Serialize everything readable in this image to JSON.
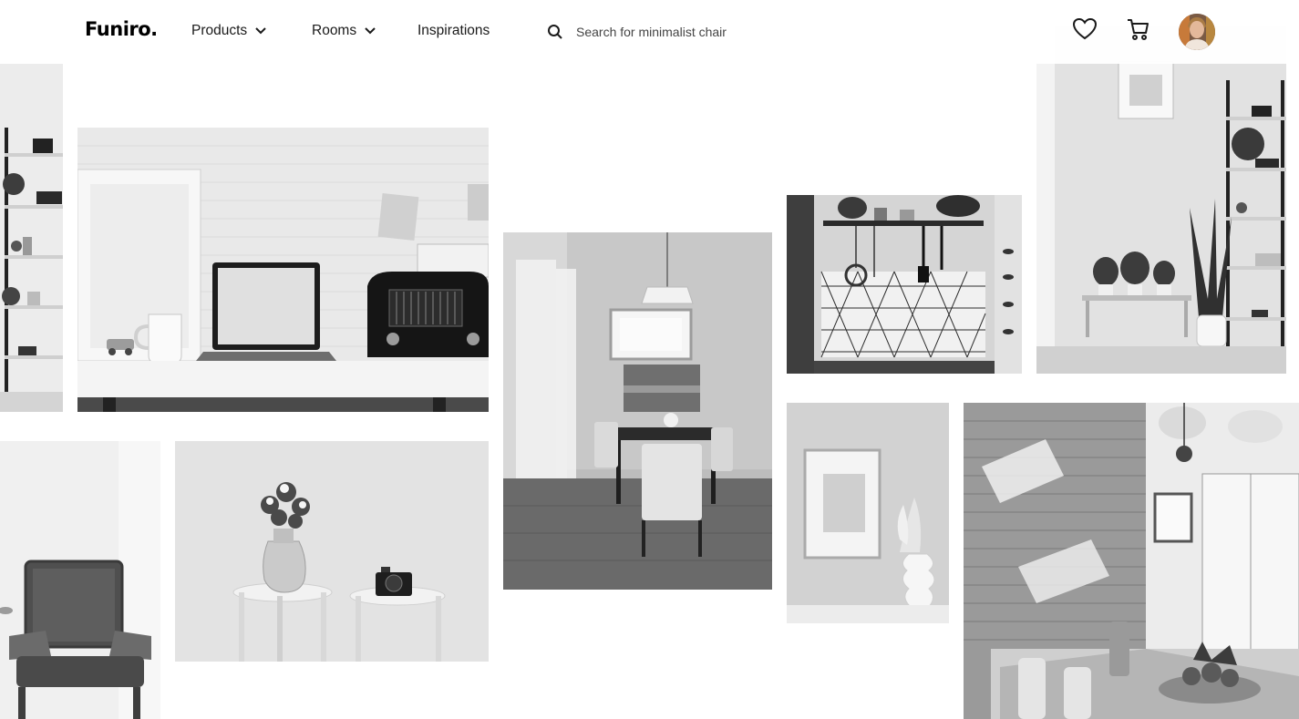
{
  "brand": {
    "logo": "Funiro."
  },
  "nav": {
    "products": "Products",
    "rooms": "Rooms",
    "inspirations": "Inspirations"
  },
  "search": {
    "placeholder": "Search for minimalist chair",
    "value": ""
  },
  "header_icons": [
    "heart-icon",
    "cart-icon",
    "user-avatar"
  ],
  "colors": {
    "text": "#1a1a1a",
    "background": "#ffffff"
  },
  "gallery": [
    "shelf-left-image",
    "desk-laptop-image",
    "dining-room-image",
    "kitchen-tiles-image",
    "shelf-plants-image",
    "armchair-image",
    "stools-vase-camera-image",
    "frame-vase-image",
    "brick-wall-dining-image"
  ]
}
